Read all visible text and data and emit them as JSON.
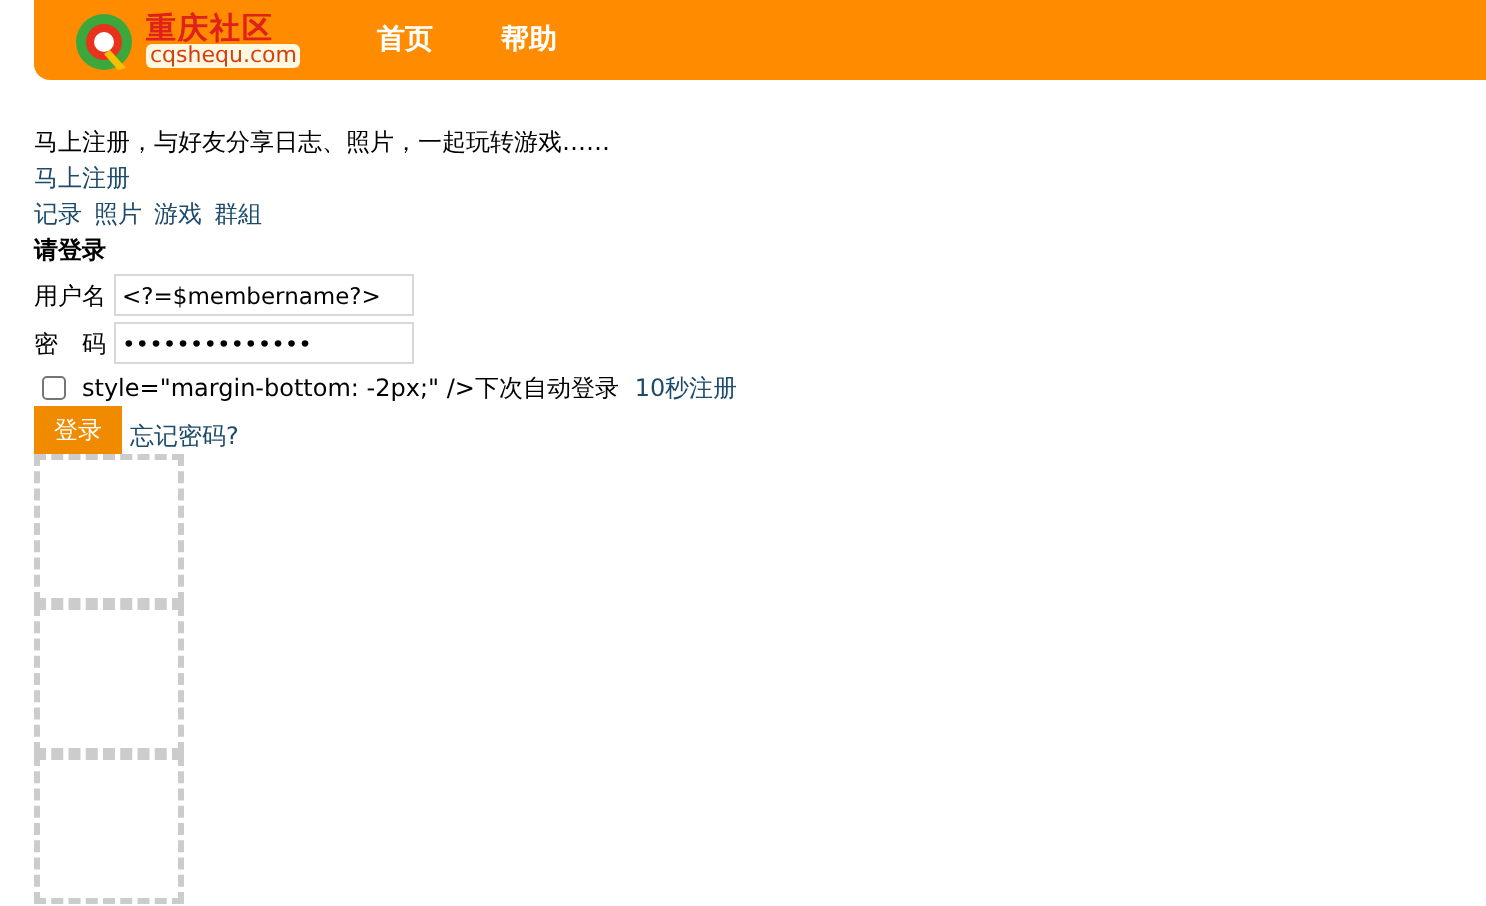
{
  "header": {
    "logo": {
      "name": "重庆社区",
      "domain": "cqshequ.com"
    },
    "nav": [
      {
        "label": "首页"
      },
      {
        "label": "帮助"
      }
    ]
  },
  "intro": "马上注册，与好友分享日志、照片，一起玩转游戏……",
  "register_link": "马上注册",
  "features": [
    "记录",
    "照片",
    "游戏",
    "群組"
  ],
  "login": {
    "title": "请登录",
    "username_label": "用户名",
    "username_value": "<?=$membername?>",
    "password_label": "密　码",
    "password_value": "••••••••••••••",
    "remember": {
      "checked": false,
      "label": "style=\"margin-bottom: -2px;\" />下次自动登录"
    },
    "quick_register": "10秒注册",
    "submit": "登录",
    "forgot": "忘记密码?"
  }
}
